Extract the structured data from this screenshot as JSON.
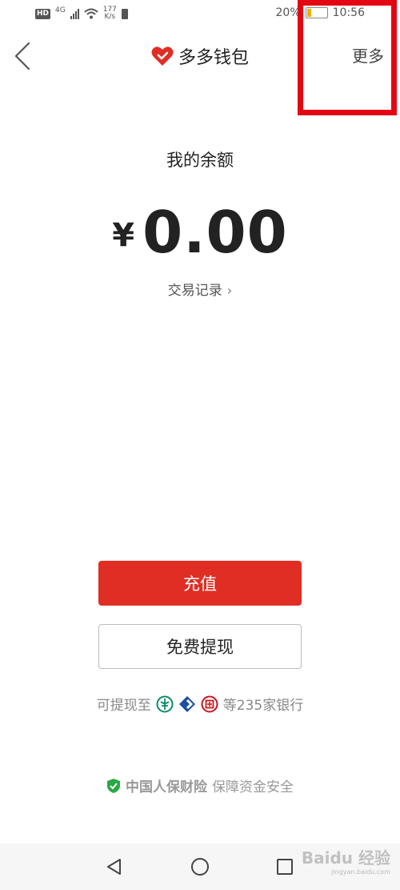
{
  "status_bar": {
    "hd": "HD",
    "network": "4G",
    "speed_value": "177",
    "speed_unit": "K/s",
    "battery_percent": "20%",
    "time": "10:56",
    "battery_level": 0.2
  },
  "header": {
    "back_icon": "chevron-left-icon",
    "title": "多多钱包",
    "more_label": "更多"
  },
  "balance": {
    "label": "我的余额",
    "currency": "¥",
    "amount": "0.00"
  },
  "transactions_link": {
    "label": "交易记录",
    "chevron": "›"
  },
  "actions": {
    "recharge_label": "充值",
    "withdraw_label": "免费提现"
  },
  "banks": {
    "prefix": "可提现至",
    "suffix": "等235家银行",
    "icons": [
      "abc-bank-icon",
      "bocom-bank-icon",
      "icbc-bank-icon"
    ]
  },
  "insurance": {
    "brand": "中国人保财险",
    "text": "保障资金安全",
    "icon": "shield-check-icon"
  },
  "watermark": {
    "text": "Baidu 经验",
    "sub": "jingyan.baidu.com"
  },
  "colors": {
    "accent": "#e02e24",
    "highlight": "#e30613",
    "shield": "#2aa845"
  }
}
